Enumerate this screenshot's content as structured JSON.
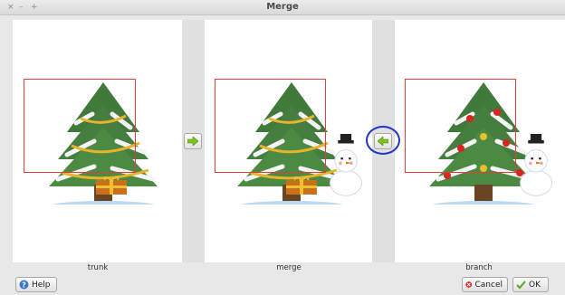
{
  "window": {
    "title": "Merge",
    "controls": [
      "×",
      "–",
      "+"
    ]
  },
  "panels": {
    "left": {
      "label": "trunk"
    },
    "middle": {
      "label": "merge"
    },
    "right": {
      "label": "branch"
    }
  },
  "buttons": {
    "help": "Help",
    "cancel": "Cancel",
    "ok": "OK"
  },
  "icons": {
    "help": "help-circle-icon",
    "cancel": "cancel-icon",
    "ok": "checkmark-icon",
    "copy_right": "arrow-right-icon",
    "copy_left": "arrow-left-icon"
  },
  "colors": {
    "selection_box": "#e53b3b",
    "highlight_circle": "#2433c8",
    "arrow": "#7cc31f"
  }
}
